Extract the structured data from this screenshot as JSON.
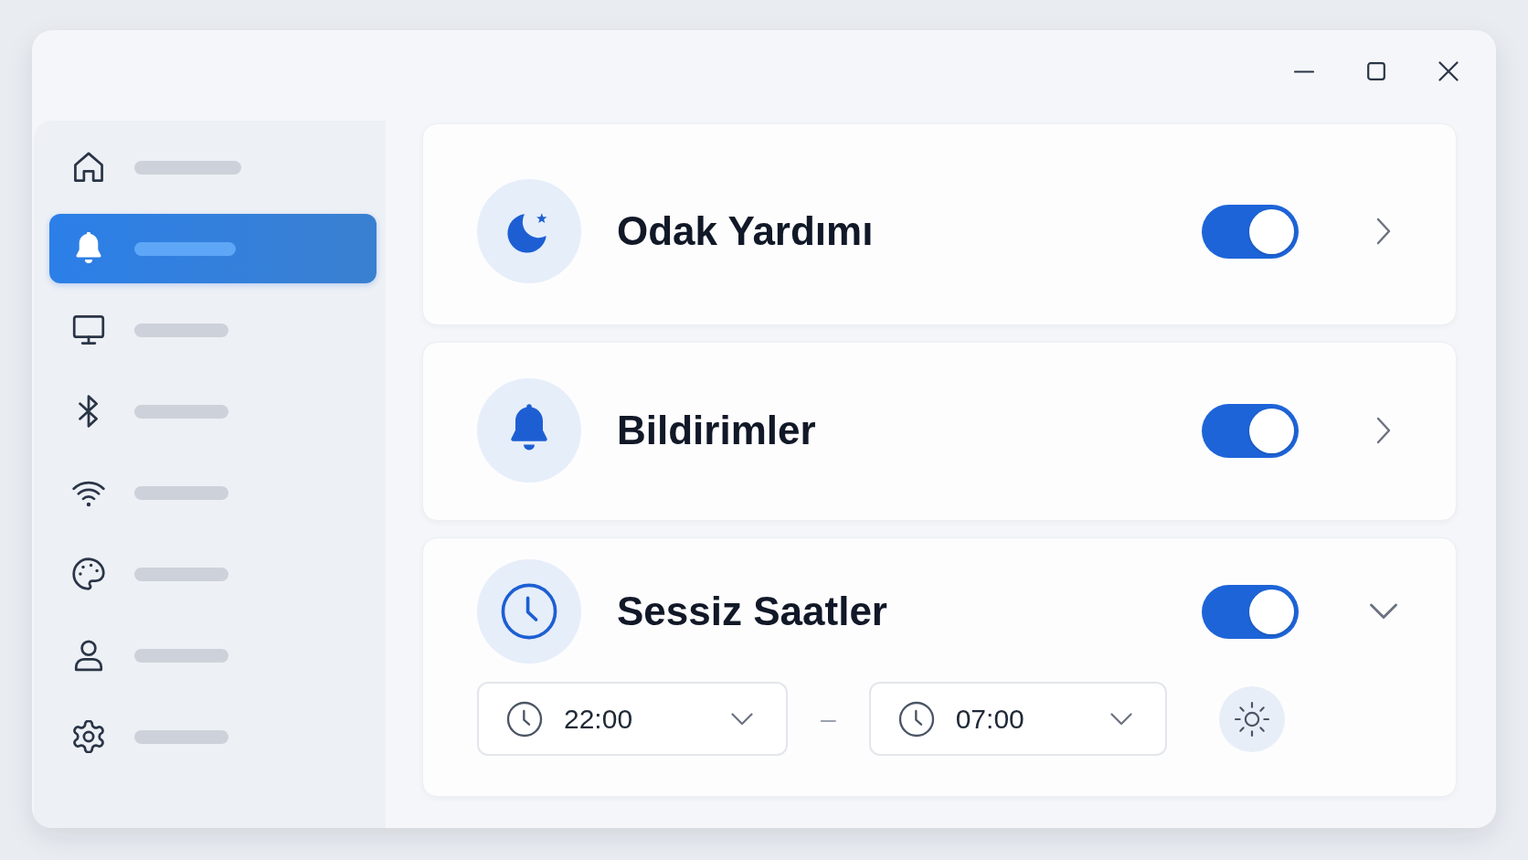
{
  "sidebar": {
    "items": [
      {
        "selected": false
      },
      {
        "selected": true
      },
      {
        "selected": false
      },
      {
        "selected": false
      },
      {
        "selected": false
      },
      {
        "selected": false
      },
      {
        "selected": false
      },
      {
        "selected": false
      }
    ]
  },
  "cards": [
    {
      "title": "Odak Yardımı",
      "on": true,
      "kind": "link"
    },
    {
      "title": "Bildirimler",
      "on": true,
      "kind": "link"
    },
    {
      "title": "Sessiz Saatler",
      "on": true,
      "kind": "expandable",
      "expanded": true,
      "schedule": {
        "start": "22:00",
        "separator": "–",
        "end": "07:00"
      }
    }
  ]
}
